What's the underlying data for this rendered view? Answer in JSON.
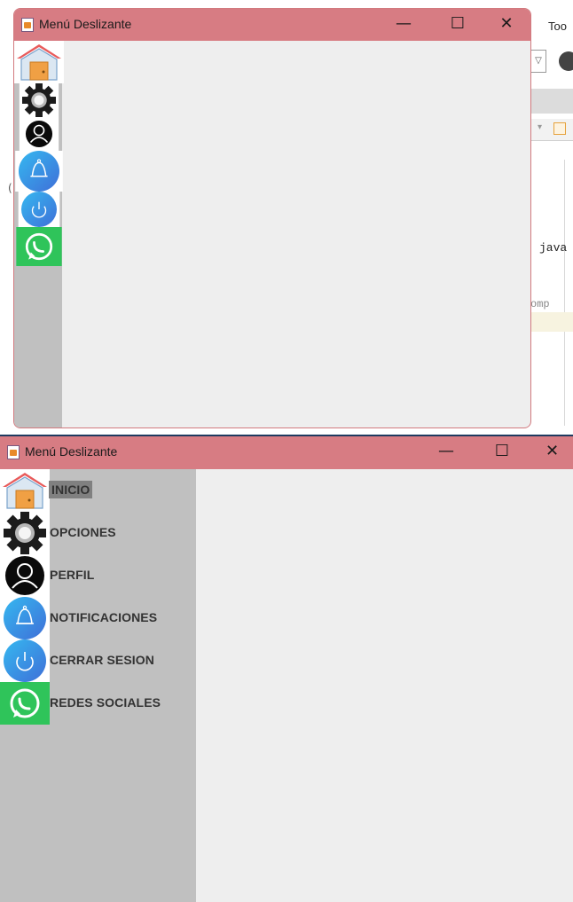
{
  "background_ide": {
    "toolbar_label": "Too",
    "code_line_1": "java",
    "code_line_2": "omp",
    "left_glyph": "("
  },
  "window_collapsed": {
    "title": "Menú Deslizante",
    "controls": {
      "minimize": "—",
      "maximize": "☐",
      "close": "✕"
    },
    "sidebar_state": "collapsed",
    "menu": [
      {
        "icon": "home-icon"
      },
      {
        "icon": "gear-icon"
      },
      {
        "icon": "user-icon"
      },
      {
        "icon": "bell-icon"
      },
      {
        "icon": "power-icon"
      },
      {
        "icon": "whatsapp-icon"
      }
    ]
  },
  "window_expanded": {
    "title": "Menú Deslizante",
    "controls": {
      "minimize": "—",
      "maximize": "☐",
      "close": "✕"
    },
    "sidebar_state": "expanded",
    "menu": [
      {
        "label": "INICIO",
        "icon": "home-icon",
        "selected": true
      },
      {
        "label": "OPCIONES",
        "icon": "gear-icon"
      },
      {
        "label": "PERFIL",
        "icon": "user-icon"
      },
      {
        "label": "NOTIFICACIONES",
        "icon": "bell-icon"
      },
      {
        "label": "CERRAR SESION",
        "icon": "power-icon"
      },
      {
        "label": "REDES SOCIALES",
        "icon": "whatsapp-icon"
      }
    ]
  },
  "colors": {
    "titlebar": "#d77c83",
    "sidebar": "#c0c0c0",
    "content": "#eeeeee",
    "selected_item": "#808080",
    "menu_text": "#333333"
  }
}
